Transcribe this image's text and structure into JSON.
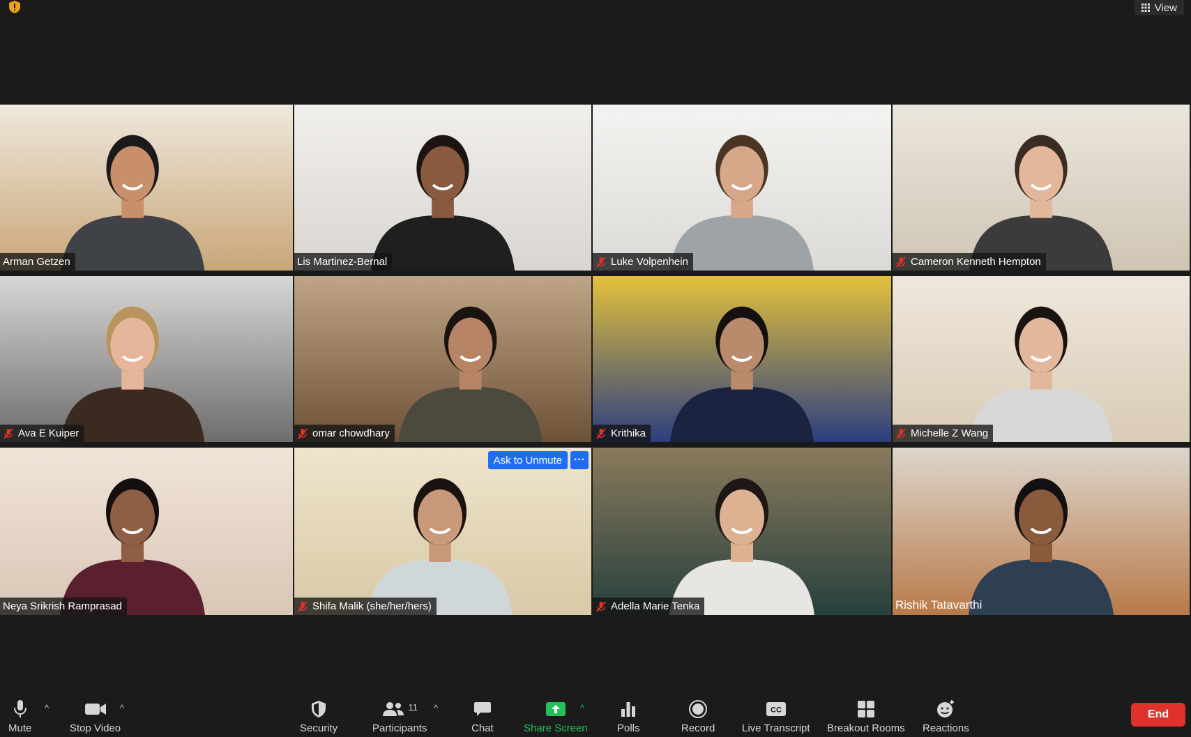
{
  "top": {
    "view_label": "View"
  },
  "participants": [
    {
      "name": "Arman Getzen",
      "muted": false,
      "bg": "#c9a679",
      "bg2": "#efe8dc",
      "shirt": "#3f4347",
      "skin": "#c98f6a",
      "hair": "#1a1a1a"
    },
    {
      "name": "Lis Martinez-Bernal",
      "muted": false,
      "bg": "#d9d6d1",
      "bg2": "#f1efec",
      "shirt": "#1f1f1f",
      "skin": "#8a5a3e",
      "hair": "#1c1410"
    },
    {
      "name": "Luke Volpenhein",
      "muted": true,
      "bg": "#dcdad7",
      "bg2": "#f3f3f1",
      "shirt": "#9ea3a8",
      "skin": "#d7a78a",
      "hair": "#4a3424"
    },
    {
      "name": "Cameron Kenneth Hempton",
      "muted": true,
      "bg": "#cfc5b3",
      "bg2": "#ebe6dd",
      "shirt": "#3b3b3b",
      "skin": "#e2b79c",
      "hair": "#3a2c22"
    },
    {
      "name": "Ava E Kuiper",
      "muted": true,
      "bg": "#6f6d6b",
      "bg2": "#d9d7d5",
      "shirt": "#3a2a20",
      "skin": "#e6b69a",
      "hair": "#b8935c"
    },
    {
      "name": "omar chowdhary",
      "muted": true,
      "bg": "#6d5238",
      "bg2": "#c0a486",
      "shirt": "#4c4a3c",
      "skin": "#b78565",
      "hair": "#1a1411"
    },
    {
      "name": "Krithika",
      "muted": true,
      "bg": "#2b3e80",
      "bg2": "#e4c13b",
      "shirt": "#1a2340",
      "skin": "#b98a6c",
      "hair": "#141010"
    },
    {
      "name": "Michelle Z Wang",
      "muted": true,
      "bg": "#d9cbb6",
      "bg2": "#efe7dc",
      "shirt": "#d8d8d8",
      "skin": "#e2b89c",
      "hair": "#1a1410"
    },
    {
      "name": "Neya Srikrish Ramprasad",
      "muted": false,
      "bg": "#d9c7b6",
      "bg2": "#f1e4d8",
      "shirt": "#5a2030",
      "skin": "#8e5e45",
      "hair": "#140f0d"
    },
    {
      "name": "Shifa Malik  (she/her/hers)",
      "muted": true,
      "bg": "#d8c9a6",
      "bg2": "#efe4cc",
      "shirt": "#cfd7d9",
      "skin": "#c99a7a",
      "hair": "#1a130f"
    },
    {
      "name": "Adella Marie Tenka",
      "muted": true,
      "bg": "#26403d",
      "bg2": "#8b7a5c",
      "shirt": "#e8e6e2",
      "skin": "#dcb293",
      "hair": "#1e1713"
    },
    {
      "name": "Rishik Tatavarthi",
      "muted": false,
      "bg": "#b87a4a",
      "bg2": "#ddd6cc",
      "shirt": "#2e3f52",
      "skin": "#8a5a3c",
      "hair": "#121010"
    }
  ],
  "shifa_overlay": {
    "ask_label": "Ask to Unmute",
    "more_label": "···"
  },
  "toolbar": {
    "mute": "Mute",
    "stop_video": "Stop Video",
    "security": "Security",
    "participants": "Participants",
    "participants_count": "11",
    "chat": "Chat",
    "share_screen": "Share Screen",
    "polls": "Polls",
    "record": "Record",
    "live_transcript": "Live Transcript",
    "breakout_rooms": "Breakout Rooms",
    "reactions": "Reactions",
    "end": "End"
  },
  "colors": {
    "accent_blue": "#1e6df2",
    "share_green": "#23c05a",
    "end_red": "#e0322c",
    "active_border": "#c8e07a"
  }
}
